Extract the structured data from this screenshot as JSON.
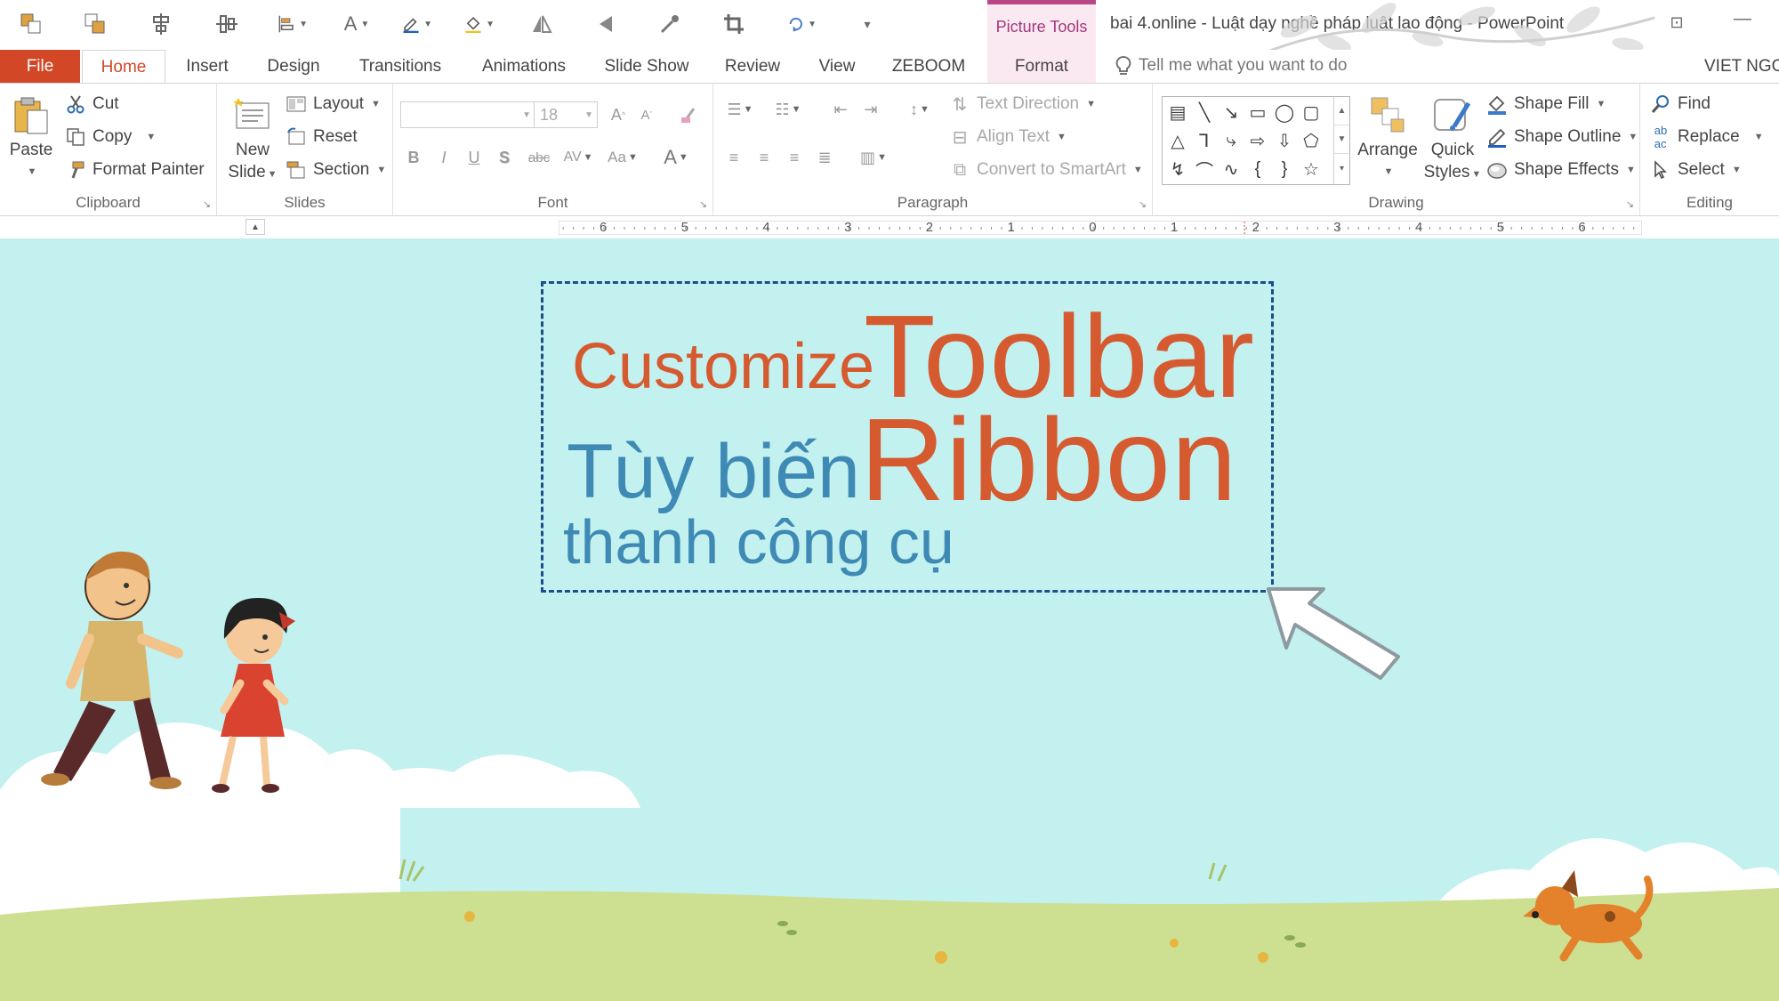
{
  "quick_access": {
    "icons": [
      "bring-forward-icon",
      "send-backward-icon",
      "align-center-icon",
      "distribute-icon",
      "align-left-icon",
      "text-style-icon",
      "pen-color-icon",
      "fill-color-icon",
      "flip-icon",
      "rotate-icon",
      "eyedropper-icon",
      "crop-icon",
      "lasso-icon",
      "customize-quick-access-icon"
    ]
  },
  "contextual": {
    "group_label": "Picture Tools",
    "tab_label": "Format"
  },
  "window": {
    "title": "bai 4.online - Luật dạy nghề pháp luật lao động - PowerPoint"
  },
  "tabs": {
    "file": "File",
    "home": "Home",
    "insert": "Insert",
    "design": "Design",
    "transitions": "Transitions",
    "animations": "Animations",
    "slide_show": "Slide Show",
    "review": "Review",
    "view": "View",
    "zeboom": "ZEBOOM",
    "tell_me": "Tell me what you want to do",
    "user": "VIET NGO"
  },
  "ribbon": {
    "clipboard": {
      "paste": "Paste",
      "cut": "Cut",
      "copy": "Copy",
      "format_painter": "Format Painter",
      "label": "Clipboard"
    },
    "slides": {
      "new_slide_1": "New",
      "new_slide_2": "Slide",
      "layout": "Layout",
      "reset": "Reset",
      "section": "Section",
      "label": "Slides"
    },
    "font": {
      "font_name": "",
      "font_size": "18",
      "label": "Font",
      "bold": "B",
      "italic": "I",
      "underline": "U",
      "shadow": "S",
      "strike": "abc",
      "spacing": "AV",
      "case": "Aa",
      "color": "A"
    },
    "paragraph": {
      "text_direction": "Text Direction",
      "align_text": "Align Text",
      "convert_smartart": "Convert to SmartArt",
      "label": "Paragraph"
    },
    "drawing": {
      "arrange": "Arrange",
      "quick_1": "Quick",
      "quick_2": "Styles",
      "shape_fill": "Shape Fill",
      "shape_outline": "Shape Outline",
      "shape_effects": "Shape Effects",
      "label": "Drawing"
    },
    "editing": {
      "find": "Find",
      "replace": "Replace",
      "select": "Select",
      "label": "Editing"
    }
  },
  "ruler": {
    "labels": [
      "6",
      "5",
      "4",
      "3",
      "2",
      "1",
      "0",
      "1",
      "2",
      "3",
      "4",
      "5",
      "6"
    ]
  },
  "slide": {
    "line1_small": "Customize",
    "line1_big": "Toolbar",
    "line2_small": "Tùy biến",
    "line2_big": "Ribbon",
    "line3": "thanh công cụ"
  },
  "colors": {
    "accent": "#d24726",
    "title_orange": "#d65a2f",
    "title_blue": "#3e8ab5",
    "slide_bg": "#c3f1ef",
    "grass": "#cddf91"
  }
}
